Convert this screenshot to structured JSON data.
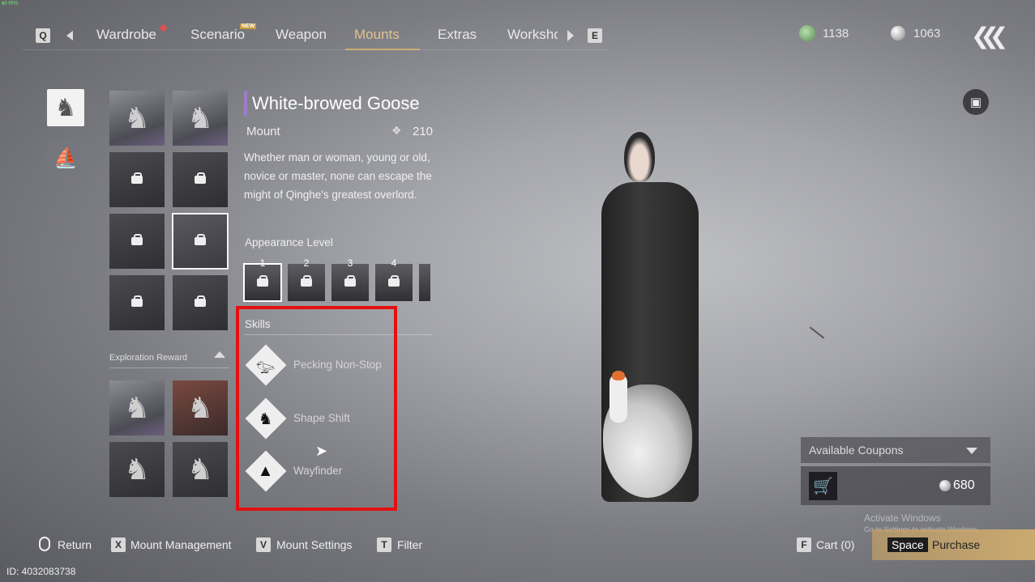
{
  "fps": "60 FPS",
  "nav": {
    "left_key": "Q",
    "right_key": "E",
    "tabs": [
      {
        "label": "Wardrobe"
      },
      {
        "label": "Scenario",
        "badge": "NEW"
      },
      {
        "label": "Weapon"
      },
      {
        "label": "Mounts"
      },
      {
        "label": "Extras"
      },
      {
        "label": "Worksho"
      }
    ],
    "active_tab": "Mounts"
  },
  "currency": {
    "jade": "1138",
    "pearl": "1063"
  },
  "categories": [
    {
      "icon": "horse-icon",
      "selected": true
    },
    {
      "icon": "boat-icon",
      "selected": false
    }
  ],
  "thumbnails": [
    {
      "icon": "horse-icon",
      "locked": false,
      "style": "light"
    },
    {
      "icon": "horse-icon",
      "locked": false,
      "style": "light"
    },
    {
      "icon": "horse-icon",
      "locked": true
    },
    {
      "icon": "horse-icon",
      "locked": true
    },
    {
      "icon": "horse-icon",
      "locked": true
    },
    {
      "icon": "goose-icon",
      "locked": true,
      "selected": true
    },
    {
      "icon": "horse-icon",
      "locked": true
    },
    {
      "icon": "horse-icon",
      "locked": true
    }
  ],
  "exploration": {
    "label": "Exploration Reward",
    "thumbnails": [
      {
        "icon": "horse-icon"
      },
      {
        "icon": "horse-icon"
      },
      {
        "icon": "horse-icon"
      },
      {
        "icon": "horse-icon"
      }
    ]
  },
  "detail": {
    "name": "White-browed Goose",
    "type": "Mount",
    "score": "210",
    "description": "Whether man or woman, young or old, novice or master, none can escape the might of Qinghe's greatest overlord.",
    "appearance_label": "Appearance Level",
    "levels": [
      "1",
      "2",
      "3",
      "4"
    ],
    "skills_label": "Skills",
    "skills": [
      {
        "name": "Pecking Non-Stop",
        "icon": "goose-icon"
      },
      {
        "name": "Shape Shift",
        "icon": "dragon-icon"
      },
      {
        "name": "Wayfinder",
        "icon": "mountain-icon"
      }
    ]
  },
  "purchase": {
    "coupons_label": "Available Coupons",
    "price": "680",
    "cart_key": "F",
    "cart_label": "Cart (0)",
    "purchase_key": "Space",
    "purchase_label": "Purchase"
  },
  "footer": {
    "return_label": "Return",
    "management_key": "X",
    "management_label": "Mount Management",
    "settings_key": "V",
    "settings_label": "Mount Settings",
    "filter_key": "T",
    "filter_label": "Filter",
    "id_text": "ID: 4032083738"
  },
  "watermark": {
    "line1": "Activate Windows",
    "line2": "Go to Settings to activate Windows."
  },
  "colors": {
    "accent_gold": "#e2c28e",
    "highlight_red": "#e41010",
    "title_bar": "#9a7fc4"
  }
}
